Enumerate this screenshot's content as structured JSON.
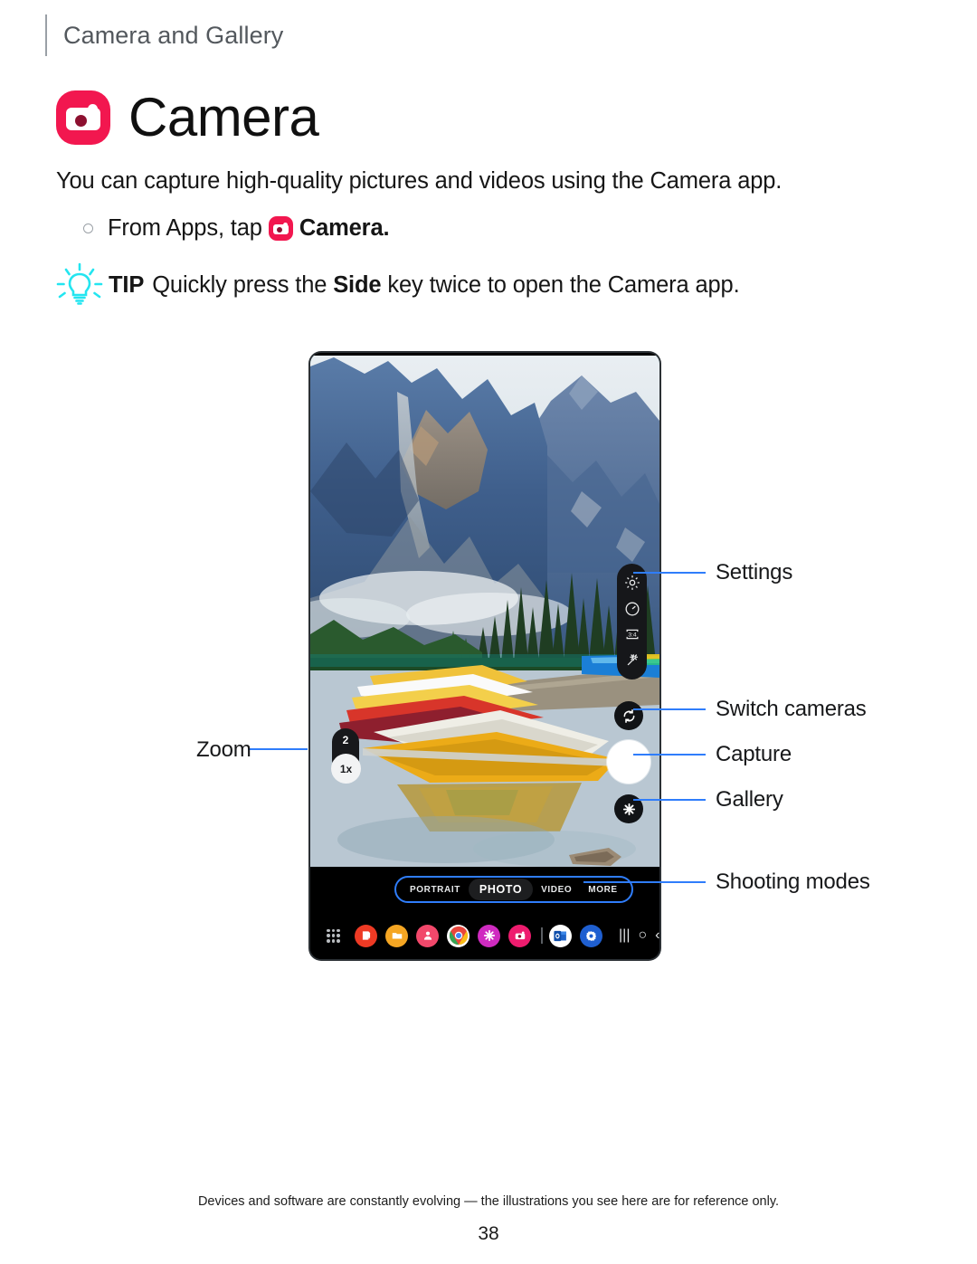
{
  "running_header": {
    "text": "Camera and Gallery"
  },
  "title": {
    "text": "Camera",
    "icon": "camera-app-icon",
    "icon_color": "#f2174f"
  },
  "intro": {
    "text": "You can capture high-quality pictures and videos using the Camera app."
  },
  "steps": [
    {
      "before": "From Apps, tap",
      "icon": "camera-app-icon",
      "app": "Camera",
      "after": "."
    }
  ],
  "tip": {
    "icon": "lightbulb-icon",
    "icon_color": "#23e5f0",
    "label": "TIP",
    "before": "Quickly press the",
    "bold": "Side",
    "after": "key twice to open the Camera app."
  },
  "device": {
    "camera_ui": {
      "controls": [
        {
          "name": "settings-gear-icon",
          "label": "Settings"
        },
        {
          "name": "timer-icon",
          "label": "Timer"
        },
        {
          "name": "aspect-ratio-icon",
          "label": "3:4"
        },
        {
          "name": "effects-wand-icon",
          "label": "Effects"
        }
      ],
      "zoom": {
        "steps": [
          "2"
        ],
        "current": "1x"
      },
      "buttons": {
        "switch_cameras": "switch-cameras-icon",
        "capture": "capture-shutter-button",
        "gallery": "gallery-thumbnail-icon"
      },
      "modes": [
        {
          "label": "PORTRAIT",
          "selected": false
        },
        {
          "label": "PHOTO",
          "selected": true
        },
        {
          "label": "VIDEO",
          "selected": false
        },
        {
          "label": "MORE",
          "selected": false
        }
      ],
      "taskbar": [
        {
          "name": "apps-grid-icon"
        },
        {
          "name": "samsung-notes-icon",
          "color": "#ee3a24"
        },
        {
          "name": "my-files-icon",
          "color": "#f5a623"
        },
        {
          "name": "contacts-icon",
          "color": "#f2486b"
        },
        {
          "name": "chrome-icon",
          "color": "#ffffff"
        },
        {
          "name": "gallery-icon",
          "color": "#cf2bc0"
        },
        {
          "name": "camera-icon",
          "color": "#ee1c6e"
        },
        {
          "name": "taskbar-divider"
        },
        {
          "name": "outlook-icon",
          "color": "#ffffff"
        },
        {
          "name": "settings-icon",
          "color": "#1f5fd0"
        }
      ],
      "nav": [
        {
          "name": "recents-nav-icon",
          "glyph": "|||"
        },
        {
          "name": "home-nav-icon",
          "glyph": "○"
        },
        {
          "name": "back-nav-icon",
          "glyph": "‹"
        }
      ]
    }
  },
  "callouts": {
    "zoom": "Zoom",
    "settings": "Settings",
    "switch_cameras": "Switch cameras",
    "capture": "Capture",
    "gallery": "Gallery",
    "shooting_modes": "Shooting modes",
    "leader_color": "#2f7dfb"
  },
  "footer": {
    "disclaimer": "Devices and software are constantly evolving — the illustrations you see here are for reference only.",
    "page_number": "38"
  }
}
